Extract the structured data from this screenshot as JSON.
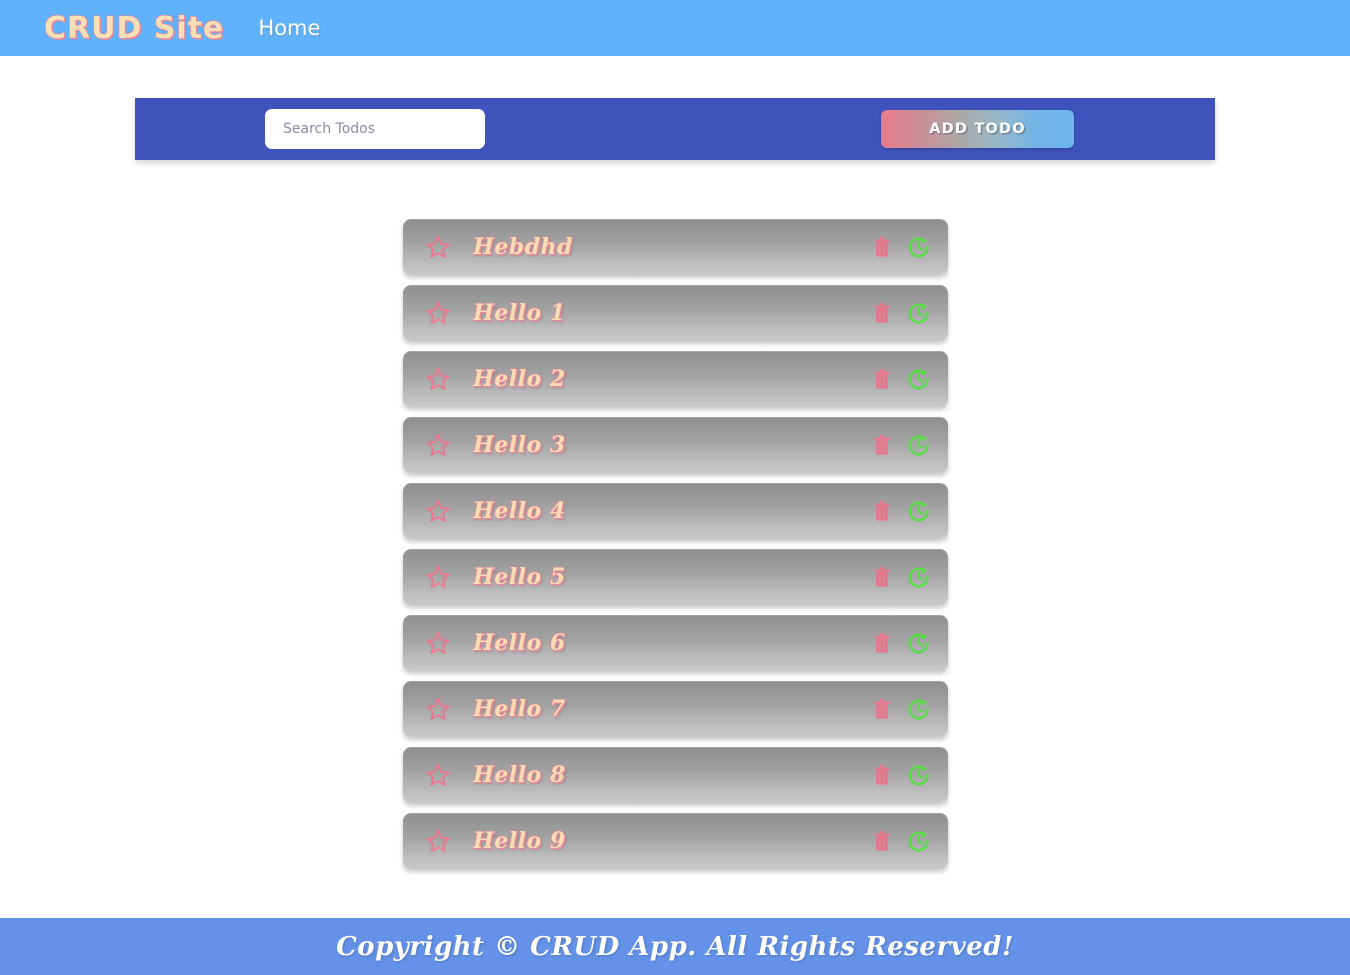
{
  "navbar": {
    "brand": "CRUD Site",
    "links": [
      {
        "label": "Home"
      }
    ]
  },
  "toolbar": {
    "search_placeholder": "Search Todos",
    "search_value": "",
    "add_button_label": "ADD TODO"
  },
  "todos": [
    {
      "text": "Hebdhd",
      "starred": false
    },
    {
      "text": "Hello 1",
      "starred": false
    },
    {
      "text": "Hello 2",
      "starred": false
    },
    {
      "text": "Hello 3",
      "starred": false
    },
    {
      "text": "Hello 4",
      "starred": false
    },
    {
      "text": "Hello 5",
      "starred": false
    },
    {
      "text": "Hello 6",
      "starred": false
    },
    {
      "text": "Hello 7",
      "starred": false
    },
    {
      "text": "Hello 8",
      "starred": false
    },
    {
      "text": "Hello 9",
      "starred": false
    }
  ],
  "item_actions": {
    "star_icon": "star-outline-icon",
    "delete_icon": "trash-icon",
    "restore_icon": "refresh-circular-arrow-icon"
  },
  "footer": {
    "text": "Copyright © CRUD App. All Rights Reserved!"
  },
  "colors": {
    "navbar_bg": "#5fb2fb",
    "toolbar_bg": "#4053bc",
    "footer_bg": "#6492e8",
    "brand_text": "#f7dfb6",
    "brand_shadow": "#e8859a",
    "todo_text": "#fadcb3",
    "star_stroke": "#e8798f",
    "trash_fill": "#e3788d",
    "restore_stroke": "#5ed94f",
    "page_bg": "#ffffff"
  }
}
